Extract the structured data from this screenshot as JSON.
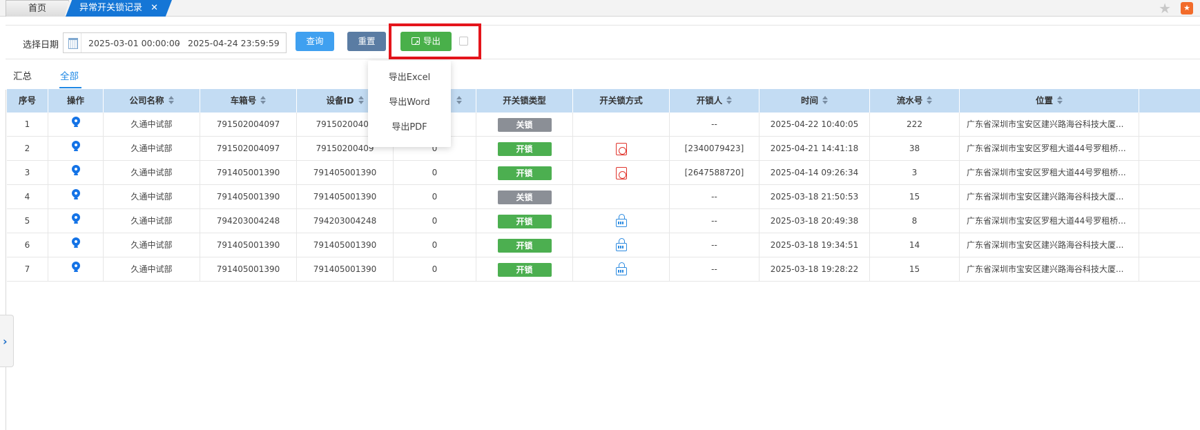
{
  "tabs": {
    "home_label": "首页",
    "active_label": "异常开关锁记录",
    "close_symbol": "✕"
  },
  "top_icons": {
    "star": "star-icon",
    "favorite": "favorite-icon"
  },
  "filter": {
    "date_label": "选择日期",
    "start": "2025-03-01 00:00:00",
    "separator": "-",
    "end": "2025-04-24 23:59:59",
    "query_label": "查询",
    "reset_label": "重置",
    "export_label": "导出"
  },
  "subtabs": {
    "summary": "汇总",
    "all": "全部"
  },
  "export_menu": {
    "excel": "导出Excel",
    "word": "导出Word",
    "pdf": "导出PDF"
  },
  "table": {
    "headers": {
      "seq": "序号",
      "op": "操作",
      "company": "公司名称",
      "box": "车箱号",
      "device": "设备ID",
      "hidden": "",
      "lock_type": "开关锁类型",
      "lock_method": "开关锁方式",
      "unlocker": "开锁人",
      "time": "时间",
      "serial": "流水号",
      "location": "位置"
    },
    "rows": [
      {
        "seq": "1",
        "company": "久通中试部",
        "box": "791502004097",
        "device": "79150200409",
        "count": "",
        "type": "关锁",
        "method": "",
        "unlocker": "--",
        "time": "2025-04-22 10:40:05",
        "serial": "222",
        "location": "广东省深圳市宝安区建兴路海谷科技大厦..."
      },
      {
        "seq": "2",
        "company": "久通中试部",
        "box": "791502004097",
        "device": "79150200409",
        "count": "0",
        "type": "开锁",
        "method": "doc",
        "unlocker": "[2340079423]",
        "time": "2025-04-21 14:41:18",
        "serial": "38",
        "location": "广东省深圳市宝安区罗租大道44号罗租桥..."
      },
      {
        "seq": "3",
        "company": "久通中试部",
        "box": "791405001390",
        "device": "791405001390",
        "count": "0",
        "type": "开锁",
        "method": "doc",
        "unlocker": "[2647588720]",
        "time": "2025-04-14 09:26:34",
        "serial": "3",
        "location": "广东省深圳市宝安区罗租大道44号罗租桥..."
      },
      {
        "seq": "4",
        "company": "久通中试部",
        "box": "791405001390",
        "device": "791405001390",
        "count": "0",
        "type": "关锁",
        "method": "",
        "unlocker": "--",
        "time": "2025-03-18 21:50:53",
        "serial": "15",
        "location": "广东省深圳市宝安区建兴路海谷科技大厦..."
      },
      {
        "seq": "5",
        "company": "久通中试部",
        "box": "794203004248",
        "device": "794203004248",
        "count": "0",
        "type": "开锁",
        "method": "lock",
        "unlocker": "--",
        "time": "2025-03-18 20:49:38",
        "serial": "8",
        "location": "广东省深圳市宝安区罗租大道44号罗租桥..."
      },
      {
        "seq": "6",
        "company": "久通中试部",
        "box": "791405001390",
        "device": "791405001390",
        "count": "0",
        "type": "开锁",
        "method": "lock",
        "unlocker": "--",
        "time": "2025-03-18 19:34:51",
        "serial": "14",
        "location": "广东省深圳市宝安区建兴路海谷科技大厦..."
      },
      {
        "seq": "7",
        "company": "久通中试部",
        "box": "791405001390",
        "device": "791405001390",
        "count": "0",
        "type": "开锁",
        "method": "lock",
        "unlocker": "--",
        "time": "2025-03-18 19:28:22",
        "serial": "15",
        "location": "广东省深圳市宝安区建兴路海谷科技大厦..."
      }
    ]
  },
  "colors": {
    "tab_active": "#1576d6",
    "header_bg": "#c3dcf3",
    "query_btn": "#3fa0f0",
    "reset_btn": "#5a7ca3",
    "export_btn": "#49b04a",
    "badge_closed": "#8b8f96",
    "badge_open": "#4caf50",
    "highlight": "#e4151b"
  }
}
